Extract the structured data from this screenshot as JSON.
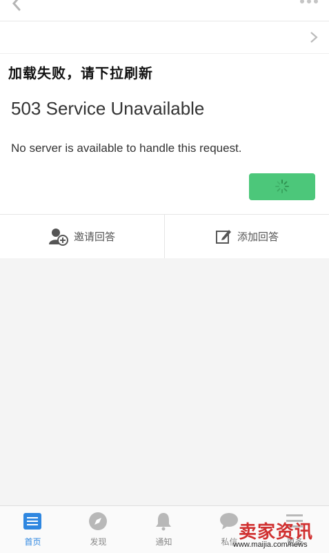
{
  "status": {
    "load_failed": "加载失败，请下拉刷新",
    "error_title": "503 Service Unavailable",
    "error_body": "No server is available to handle this request."
  },
  "actions": {
    "invite": "邀请回答",
    "add_answer": "添加回答"
  },
  "tabs": [
    {
      "label": "首页",
      "icon": "home-icon",
      "active": true
    },
    {
      "label": "发现",
      "icon": "compass-icon",
      "active": false
    },
    {
      "label": "通知",
      "icon": "bell-icon",
      "active": false
    },
    {
      "label": "私信",
      "icon": "chat-icon",
      "active": false
    },
    {
      "label": "更多",
      "icon": "more-icon",
      "active": false
    }
  ],
  "watermark": {
    "text": "卖家资讯",
    "url": "www.maijia.com/news"
  },
  "colors": {
    "accent": "#2f87e0",
    "button_green": "#4cc77a",
    "watermark_red": "#d03030"
  }
}
